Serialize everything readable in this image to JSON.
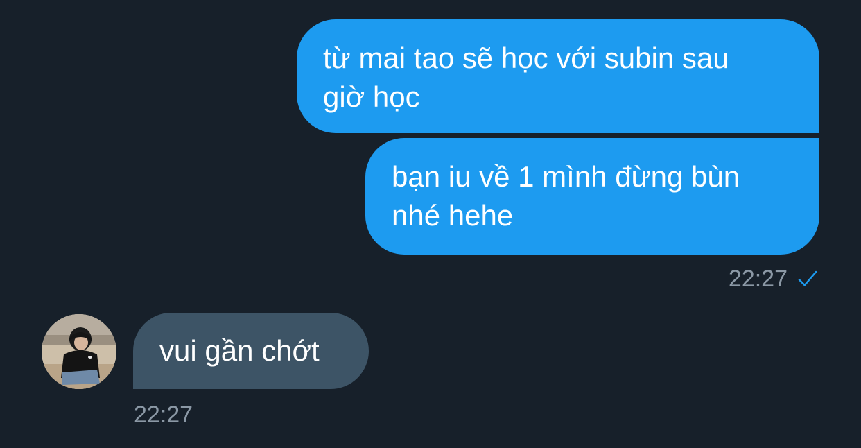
{
  "conversation": {
    "outgoing": [
      {
        "text_line1": "từ mai tao sẽ học với subin sau",
        "text_line2": "giờ học"
      },
      {
        "text_line1": "bạn iu về 1 mình đừng bùn",
        "text_line2": "nhé hehe"
      }
    ],
    "outgoing_time": "22:27",
    "outgoing_status_icon": "check-icon",
    "incoming": [
      {
        "text": "vui gần chớt"
      }
    ],
    "incoming_time": "22:27",
    "incoming_avatar_icon": "avatar"
  },
  "colors": {
    "background": "#17202a",
    "outgoing_bubble": "#1d9bf0",
    "incoming_bubble": "#3d5466",
    "timestamp": "#8b98a5",
    "check": "#1d9bf0"
  }
}
